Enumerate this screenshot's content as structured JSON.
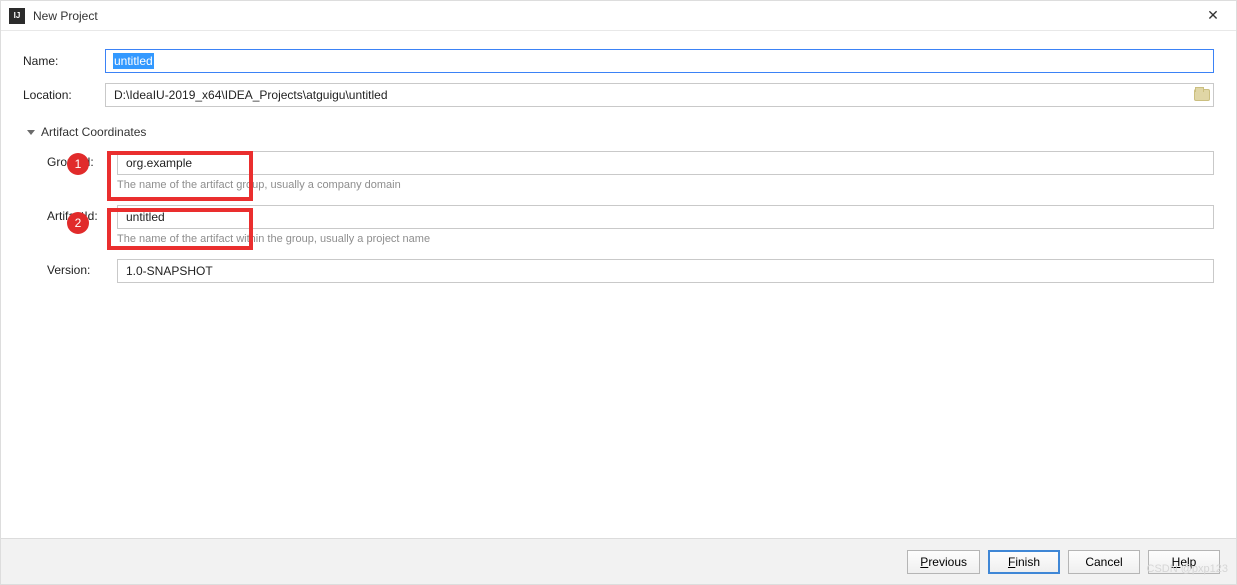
{
  "window": {
    "title": "New Project",
    "close_glyph": "✕"
  },
  "form": {
    "name_label": "Name:",
    "name_value": "untitled",
    "location_label": "Location:",
    "location_value": "D:\\IdeaIU-2019_x64\\IDEA_Projects\\atguigu\\untitled"
  },
  "artifact_section": {
    "header": "Artifact Coordinates",
    "group": {
      "label": "GroupId:",
      "value": "org.example",
      "hint": "The name of the artifact group, usually a company domain"
    },
    "artifact": {
      "label": "ArtifactId:",
      "value": "untitled",
      "hint": "The name of the artifact within the group, usually a project name"
    },
    "version": {
      "label": "Version:",
      "value": "1.0-SNAPSHOT"
    }
  },
  "annotations": {
    "badge1": "1",
    "badge2": "2"
  },
  "buttons": {
    "previous": "Previous",
    "finish": "Finish",
    "cancel": "Cancel",
    "help": "Help"
  },
  "watermark": "CSDN @pxp123"
}
